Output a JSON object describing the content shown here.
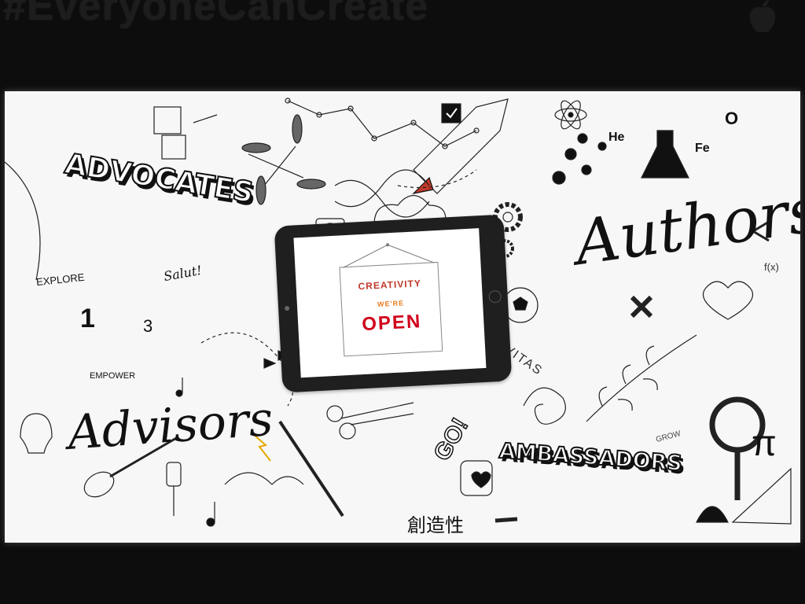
{
  "banner": {
    "hashtag": "#EveryoneCanCreate"
  },
  "mural": {
    "headings": {
      "advocates": "ADVOCATES",
      "authors": "Authors",
      "advisors": "Advisors",
      "ambassadors": "AMBASSADORS"
    },
    "small_text": {
      "salut": "Salut!",
      "cjk": "創造性",
      "civitas": "CIVITAS",
      "go": "GO!",
      "he": "He",
      "fe": "Fe",
      "oxygen": "O",
      "explore": "EXPLORE",
      "empower": "EMPOWER",
      "fx": "f(x)",
      "grow": "GROW",
      "one": "1",
      "three": "3",
      "pi": "π"
    },
    "ipad_sign": {
      "line1": "CREATIVITY",
      "line2": "WE'RE",
      "line3": "OPEN"
    }
  }
}
